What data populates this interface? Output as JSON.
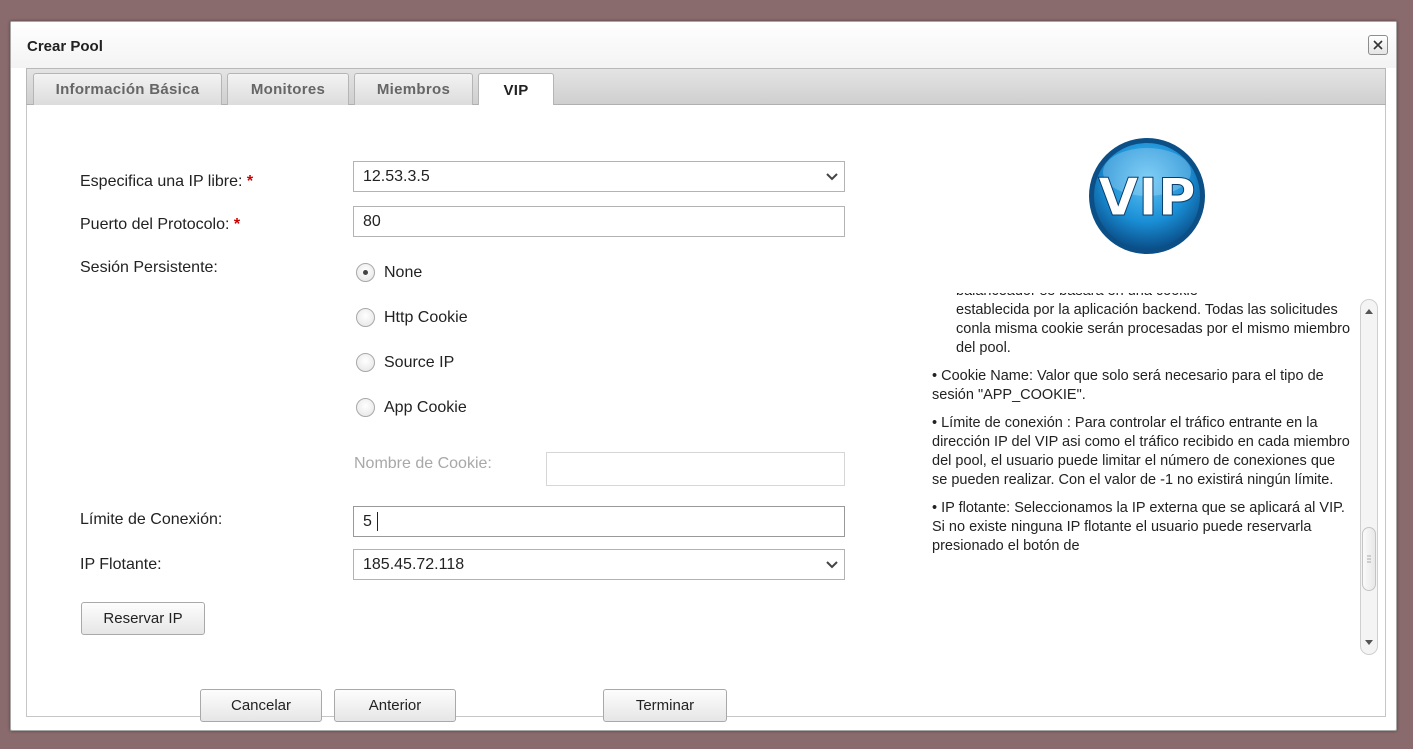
{
  "dialog": {
    "title": "Crear Pool",
    "close_icon": "close-icon"
  },
  "tabs": [
    {
      "label": "Información Básica"
    },
    {
      "label": "Monitores"
    },
    {
      "label": "Miembros"
    },
    {
      "label": "VIP",
      "active": true
    }
  ],
  "form": {
    "ip_label": "Especifica una IP libre:",
    "ip_value": "12.53.3.5",
    "port_label": "Puerto del Protocolo:",
    "port_value": "80",
    "session_label": "Sesión Persistente:",
    "session_options": [
      "None",
      "Http Cookie",
      "Source IP",
      "App Cookie"
    ],
    "session_selected": "None",
    "cookie_name_label": "Nombre de Cookie:",
    "cookie_name_value": "",
    "limit_label": "Límite de Conexión:",
    "limit_value": "5",
    "floating_label": "IP Flotante:",
    "floating_value": "185.45.72.118",
    "reserve_button": "Reservar IP",
    "required_mark": "*"
  },
  "footer": {
    "cancel": "Cancelar",
    "previous": "Anterior",
    "finish": "Terminar"
  },
  "help": {
    "logo_text": "VIP",
    "clipped_top": "balanceador se basará en una cookie",
    "p1": "establecida por la aplicación backend. Todas las solicitudes conla misma cookie serán procesadas por el mismo miembro del pool.",
    "p2": "• Cookie Name: Valor que solo será necesario para el tipo de sesión \"APP_COOKIE\".",
    "p3": "• Límite de conexión : Para controlar el tráfico entrante en la dirección IP del VIP asi como el tráfico recibido en cada miembro del pool, el usuario puede limitar el número de conexiones que se pueden realizar. Con el valor de -1 no existirá ningún límite.",
    "p4": "• IP flotante: Seleccionamos la IP externa que se aplicará al VIP. Si no existe ninguna IP flotante el usuario puede reservarla presionado el botón de"
  },
  "colors": {
    "desktop": "#8a6b6d",
    "required": "#cc0000",
    "logo_blue": "#1a8fd6"
  }
}
